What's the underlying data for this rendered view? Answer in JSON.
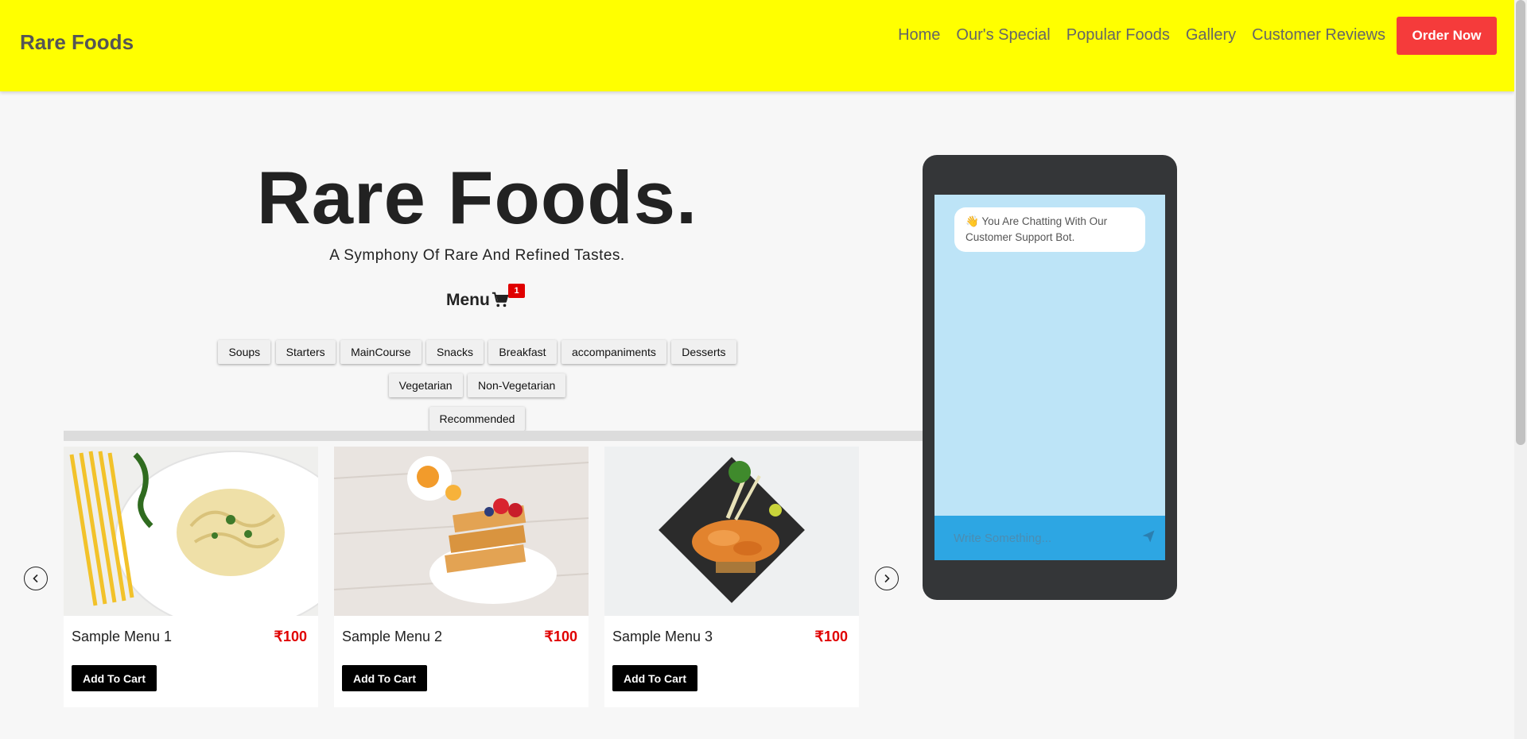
{
  "header": {
    "brand": "Rare Foods",
    "nav": [
      "Home",
      "Our's Special",
      "Popular Foods",
      "Gallery",
      "Customer Reviews"
    ],
    "order_label": "Order Now",
    "colors": {
      "background": "#ffff00",
      "order_button": "#f53b3b"
    }
  },
  "hero": {
    "title": "Rare Foods.",
    "subtitle": "A Symphony Of Rare And Refined Tastes."
  },
  "menu": {
    "label": "Menu",
    "cart_count": "1",
    "filters_row1": [
      "Soups",
      "Starters",
      "MainCourse",
      "Snacks",
      "Breakfast",
      "accompaniments",
      "Desserts"
    ],
    "filters_row2": [
      "Vegetarian",
      "Non-Vegetarian"
    ],
    "filters_row3": [
      "Recommended"
    ]
  },
  "carousel": {
    "cards": [
      {
        "name": "Sample Menu 1",
        "price": "₹100",
        "button": "Add To Cart",
        "image": "pasta-plate"
      },
      {
        "name": "Sample Menu 2",
        "price": "₹100",
        "button": "Add To Cart",
        "image": "waffles-berries"
      },
      {
        "name": "Sample Menu 3",
        "price": "₹100",
        "button": "Add To Cart",
        "image": "noodle-dish"
      }
    ]
  },
  "chat": {
    "greeting": "👋 You Are Chatting With Our Customer Support Bot.",
    "input_placeholder": "Write Something...",
    "colors": {
      "screen": "#bde4f7",
      "input": "#2da6e3",
      "frame": "#343638"
    }
  }
}
